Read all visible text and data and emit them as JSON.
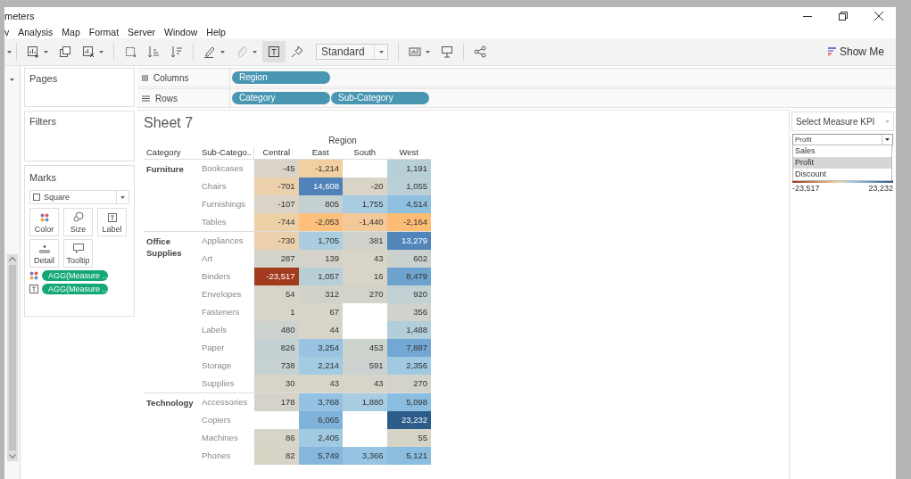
{
  "window": {
    "title": "meters"
  },
  "menu": [
    {
      "label": "v"
    },
    {
      "label": "Analysis"
    },
    {
      "label": "Map"
    },
    {
      "label": "Format"
    },
    {
      "label": "Server"
    },
    {
      "label": "Window"
    },
    {
      "label": "Help"
    }
  ],
  "toolbar": {
    "mark_labels_on": true,
    "fit": "Standard",
    "show_me": "Show Me"
  },
  "pages": {
    "title": "Pages"
  },
  "shelves": [
    {
      "kind": "columns",
      "label": "Columns",
      "pills": [
        "Region"
      ]
    },
    {
      "kind": "rows",
      "label": "Rows",
      "pills": [
        "Category",
        "Sub-Category"
      ]
    }
  ],
  "filters": {
    "title": "Filters"
  },
  "marks": {
    "title": "Marks",
    "mark_type": "Square",
    "cards": [
      {
        "kind": "color",
        "label": "Color"
      },
      {
        "kind": "size",
        "label": "Size"
      },
      {
        "kind": "label",
        "label": "Label"
      },
      {
        "kind": "detail",
        "label": "Detail"
      },
      {
        "kind": "tooltip",
        "label": "Tooltip"
      }
    ],
    "fields": [
      {
        "kind": "color",
        "pill": "AGG(Measure .."
      },
      {
        "kind": "label",
        "pill": "AGG(Measure .."
      }
    ]
  },
  "sheet": {
    "title": "Sheet 7",
    "column_group": "Region",
    "headers": [
      "Category",
      "Sub-Catego..",
      "Central",
      "East",
      "South",
      "West"
    ],
    "groups": [
      {
        "category": "Furniture",
        "rows": [
          {
            "sub": "Bookcases",
            "cells": [
              {
                "value": "-45",
                "color": "#d9d4c7"
              },
              {
                "value": "-1,214",
                "color": "#f2cfa1"
              },
              null,
              {
                "value": "1,191",
                "color": "#b7cfd7"
              }
            ]
          },
          {
            "sub": "Chairs",
            "cells": [
              {
                "value": "-701",
                "color": "#ebd0ab"
              },
              {
                "value": "14,608",
                "color": "#4f82b8"
              },
              {
                "value": "-20",
                "color": "#dad4c8"
              },
              {
                "value": "1,055",
                "color": "#bbd0d6"
              }
            ]
          },
          {
            "sub": "Furnishings",
            "cells": [
              {
                "value": "-107",
                "color": "#dad4c8"
              },
              {
                "value": "805",
                "color": "#c5d1d1"
              },
              {
                "value": "1,755",
                "color": "#a9cde0"
              },
              {
                "value": "4,514",
                "color": "#90c0e0"
              }
            ]
          },
          {
            "sub": "Tables",
            "cells": [
              {
                "value": "-744",
                "color": "#eed0a6"
              },
              {
                "value": "-2,053",
                "color": "#fcc07c"
              },
              {
                "value": "-1,440",
                "color": "#f4c99a"
              },
              {
                "value": "-2,164",
                "color": "#fdbc73"
              }
            ]
          }
        ]
      },
      {
        "category": "Office Supplies",
        "rows": [
          {
            "sub": "Appliances",
            "cells": [
              {
                "value": "-730",
                "color": "#ebd0ab"
              },
              {
                "value": "1,705",
                "color": "#aacde0"
              },
              {
                "value": "381",
                "color": "#d0d3cc"
              },
              {
                "value": "13,279",
                "color": "#5286bb"
              }
            ]
          },
          {
            "sub": "Art",
            "cells": [
              {
                "value": "287",
                "color": "#d2d3cb"
              },
              {
                "value": "139",
                "color": "#d5d3c9"
              },
              {
                "value": "43",
                "color": "#d8d4c8"
              },
              {
                "value": "602",
                "color": "#cad2cf"
              }
            ]
          },
          {
            "sub": "Binders",
            "cells": [
              {
                "value": "-23,517",
                "color": "#a23b1e"
              },
              {
                "value": "1,057",
                "color": "#b9cfd8"
              },
              {
                "value": "16",
                "color": "#d8d4c8"
              },
              {
                "value": "8,479",
                "color": "#6ea3d0"
              }
            ]
          },
          {
            "sub": "Envelopes",
            "cells": [
              {
                "value": "54",
                "color": "#d7d4c8"
              },
              {
                "value": "312",
                "color": "#d1d3cb"
              },
              {
                "value": "270",
                "color": "#d3d3ca"
              },
              {
                "value": "920",
                "color": "#c2d1d3"
              }
            ]
          },
          {
            "sub": "Fasteners",
            "cells": [
              {
                "value": "1",
                "color": "#d8d4c8"
              },
              {
                "value": "67",
                "color": "#d7d4c8"
              },
              null,
              {
                "value": "356",
                "color": "#cfd3cb"
              }
            ]
          },
          {
            "sub": "Labels",
            "cells": [
              {
                "value": "480",
                "color": "#ccd2ce"
              },
              {
                "value": "44",
                "color": "#d7d4c8"
              },
              null,
              {
                "value": "1,488",
                "color": "#b1ced9"
              }
            ]
          },
          {
            "sub": "Paper",
            "cells": [
              {
                "value": "826",
                "color": "#c3d1d3"
              },
              {
                "value": "3,254",
                "color": "#98c4e2"
              },
              {
                "value": "453",
                "color": "#cdd3cd"
              },
              {
                "value": "7,887",
                "color": "#74a8d4"
              }
            ]
          },
          {
            "sub": "Storage",
            "cells": [
              {
                "value": "738",
                "color": "#c6d1d1"
              },
              {
                "value": "2,214",
                "color": "#a3cbe1"
              },
              {
                "value": "591",
                "color": "#cbd2cf"
              },
              {
                "value": "2,356",
                "color": "#9fcae2"
              }
            ]
          },
          {
            "sub": "Supplies",
            "cells": [
              {
                "value": "30",
                "color": "#d8d4c8"
              },
              {
                "value": "43",
                "color": "#d7d4c8"
              },
              {
                "value": "43",
                "color": "#d7d4c9"
              },
              {
                "value": "270",
                "color": "#d3d3ca"
              }
            ]
          }
        ]
      },
      {
        "category": "Technology",
        "rows": [
          {
            "sub": "Accessories",
            "cells": [
              {
                "value": "178",
                "color": "#d5d3c9"
              },
              {
                "value": "3,768",
                "color": "#93c2e3"
              },
              {
                "value": "1,880",
                "color": "#a8cde1"
              },
              {
                "value": "5,098",
                "color": "#8bbde0"
              }
            ]
          },
          {
            "sub": "Copiers",
            "cells": [
              null,
              {
                "value": "6,065",
                "color": "#80b3da"
              },
              null,
              {
                "value": "23,232",
                "color": "#2b5c8a"
              }
            ]
          },
          {
            "sub": "Machines",
            "cells": [
              {
                "value": "86",
                "color": "#d7d4c8"
              },
              {
                "value": "2,405",
                "color": "#a0cae1"
              },
              null,
              {
                "value": "55",
                "color": "#d7d4c7"
              }
            ]
          },
          {
            "sub": "Phones",
            "cells": [
              {
                "value": "82",
                "color": "#d7d4c6"
              },
              {
                "value": "5,749",
                "color": "#85b7dd"
              },
              {
                "value": "3,366",
                "color": "#96c4e2"
              },
              {
                "value": "5,121",
                "color": "#8bbde1"
              }
            ]
          }
        ]
      }
    ]
  },
  "parameter": {
    "title": "Select Measure KPI",
    "value": "Profit",
    "options": [
      {
        "label": "Sales",
        "selected": false
      },
      {
        "label": "Profit",
        "selected": true
      },
      {
        "label": "Discount",
        "selected": false
      }
    ],
    "legend": {
      "min": "-23,517",
      "max": "23,232"
    }
  }
}
